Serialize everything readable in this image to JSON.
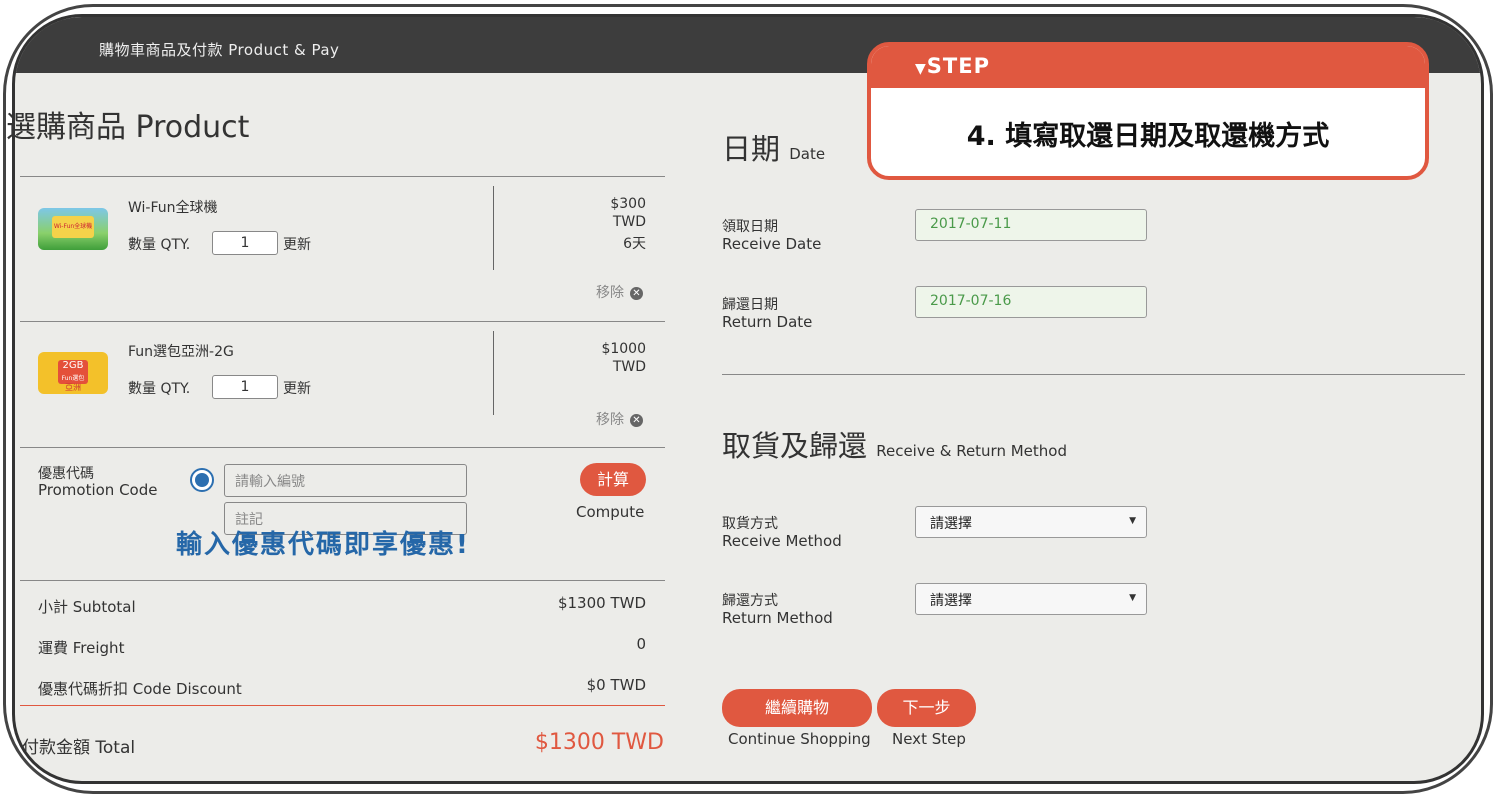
{
  "header": {
    "title": "購物車商品及付款 Product & Pay"
  },
  "products_section": {
    "title": "選購商品 Product"
  },
  "products": [
    {
      "name": "Wi-Fun全球機",
      "qty_label": "數量 QTY.",
      "qty": "1",
      "update": "更新",
      "price": "$300",
      "currency": "TWD",
      "days": "6天",
      "remove": "移除",
      "thumb_text": "Wi-Fun全球機"
    },
    {
      "name": "Fun選包亞洲-2G",
      "qty_label": "數量 QTY.",
      "qty": "1",
      "update": "更新",
      "price": "$1000",
      "currency": "TWD",
      "remove": "移除",
      "thumb_text": "2GB",
      "thumb_sub": "Fun選包",
      "thumb_sub2": "亞洲"
    }
  ],
  "promo": {
    "label_zh": "優惠代碼",
    "label_en": "Promotion Code",
    "placeholder_code": "請輸入編號",
    "placeholder_note": "註記",
    "compute_zh": "計算",
    "compute_en": "Compute",
    "banner": "輸入優惠代碼即享優惠!"
  },
  "summary": {
    "subtotal_label": "小計 Subtotal",
    "subtotal": "$1300 TWD",
    "freight_label": "運費 Freight",
    "freight": "0",
    "discount_label": "優惠代碼折扣 Code Discount",
    "discount": "$0 TWD",
    "total_label": "付款金額 Total",
    "total": "$1300 TWD"
  },
  "date_section": {
    "title_zh": "日期",
    "title_en": "Date",
    "receive_zh": "領取日期",
    "receive_en": "Receive Date",
    "receive_value": "2017-07-11",
    "return_zh": "歸還日期",
    "return_en": "Return Date",
    "return_value": "2017-07-16"
  },
  "method_section": {
    "title_zh": "取貨及歸還",
    "title_en": "Receive & Return Method",
    "receive_zh": "取貨方式",
    "receive_en": "Receive Method",
    "receive_value": "請選擇",
    "return_zh": "歸還方式",
    "return_en": "Return Method",
    "return_value": "請選擇"
  },
  "buttons": {
    "continue_zh": "繼續購物",
    "continue_en": "Continue Shopping",
    "next_zh": "下一步",
    "next_en": "Next Step"
  },
  "step": {
    "label": "STEP",
    "text": "4. 填寫取還日期及取還機方式"
  },
  "colors": {
    "accent": "#e05840",
    "header": "#3d3d3d",
    "promo_blue": "#2567a8",
    "date_green": "#4a9a4a"
  }
}
